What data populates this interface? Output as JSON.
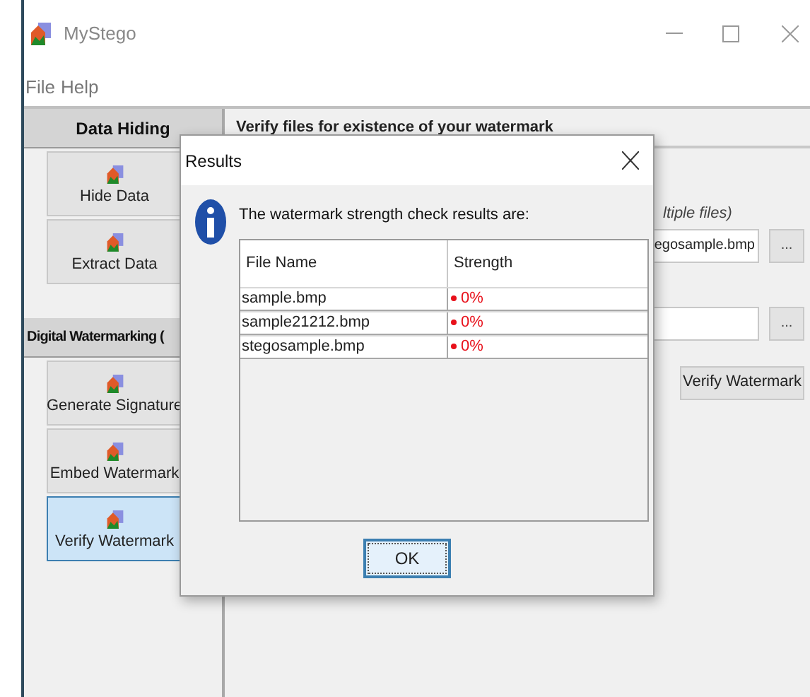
{
  "window": {
    "title": "MyStego"
  },
  "menu": [
    "File",
    "Help"
  ],
  "sidebar": {
    "sections": [
      {
        "title": "Data Hiding",
        "items": [
          {
            "label": "Hide Data",
            "selected": false
          },
          {
            "label": "Extract Data",
            "selected": false
          }
        ]
      },
      {
        "title": "Digital Watermarking (",
        "items": [
          {
            "label": "Generate Signature",
            "selected": false
          },
          {
            "label": "Embed Watermark",
            "selected": false
          },
          {
            "label": "Verify Watermark",
            "selected": true
          }
        ]
      }
    ]
  },
  "panel": {
    "heading": "Verify files for existence of your watermark",
    "files_label": "ltiple files)",
    "files_field": {
      "value": "egosample.bmp"
    },
    "browse_buttons": [
      "...",
      "..."
    ],
    "verify_button": "Verify Watermark"
  },
  "dialog": {
    "title": "Results",
    "message": "The watermark strength check results are:",
    "columns": [
      "File Name",
      "Strength"
    ],
    "rows": [
      {
        "file": "sample.bmp",
        "strength": "0%",
        "color": "#e8101a"
      },
      {
        "file": "sample21212.bmp",
        "strength": "0%",
        "color": "#e8101a"
      },
      {
        "file": "stegosample.bmp",
        "strength": "0%",
        "color": "#e8101a"
      }
    ],
    "ok": "OK"
  }
}
